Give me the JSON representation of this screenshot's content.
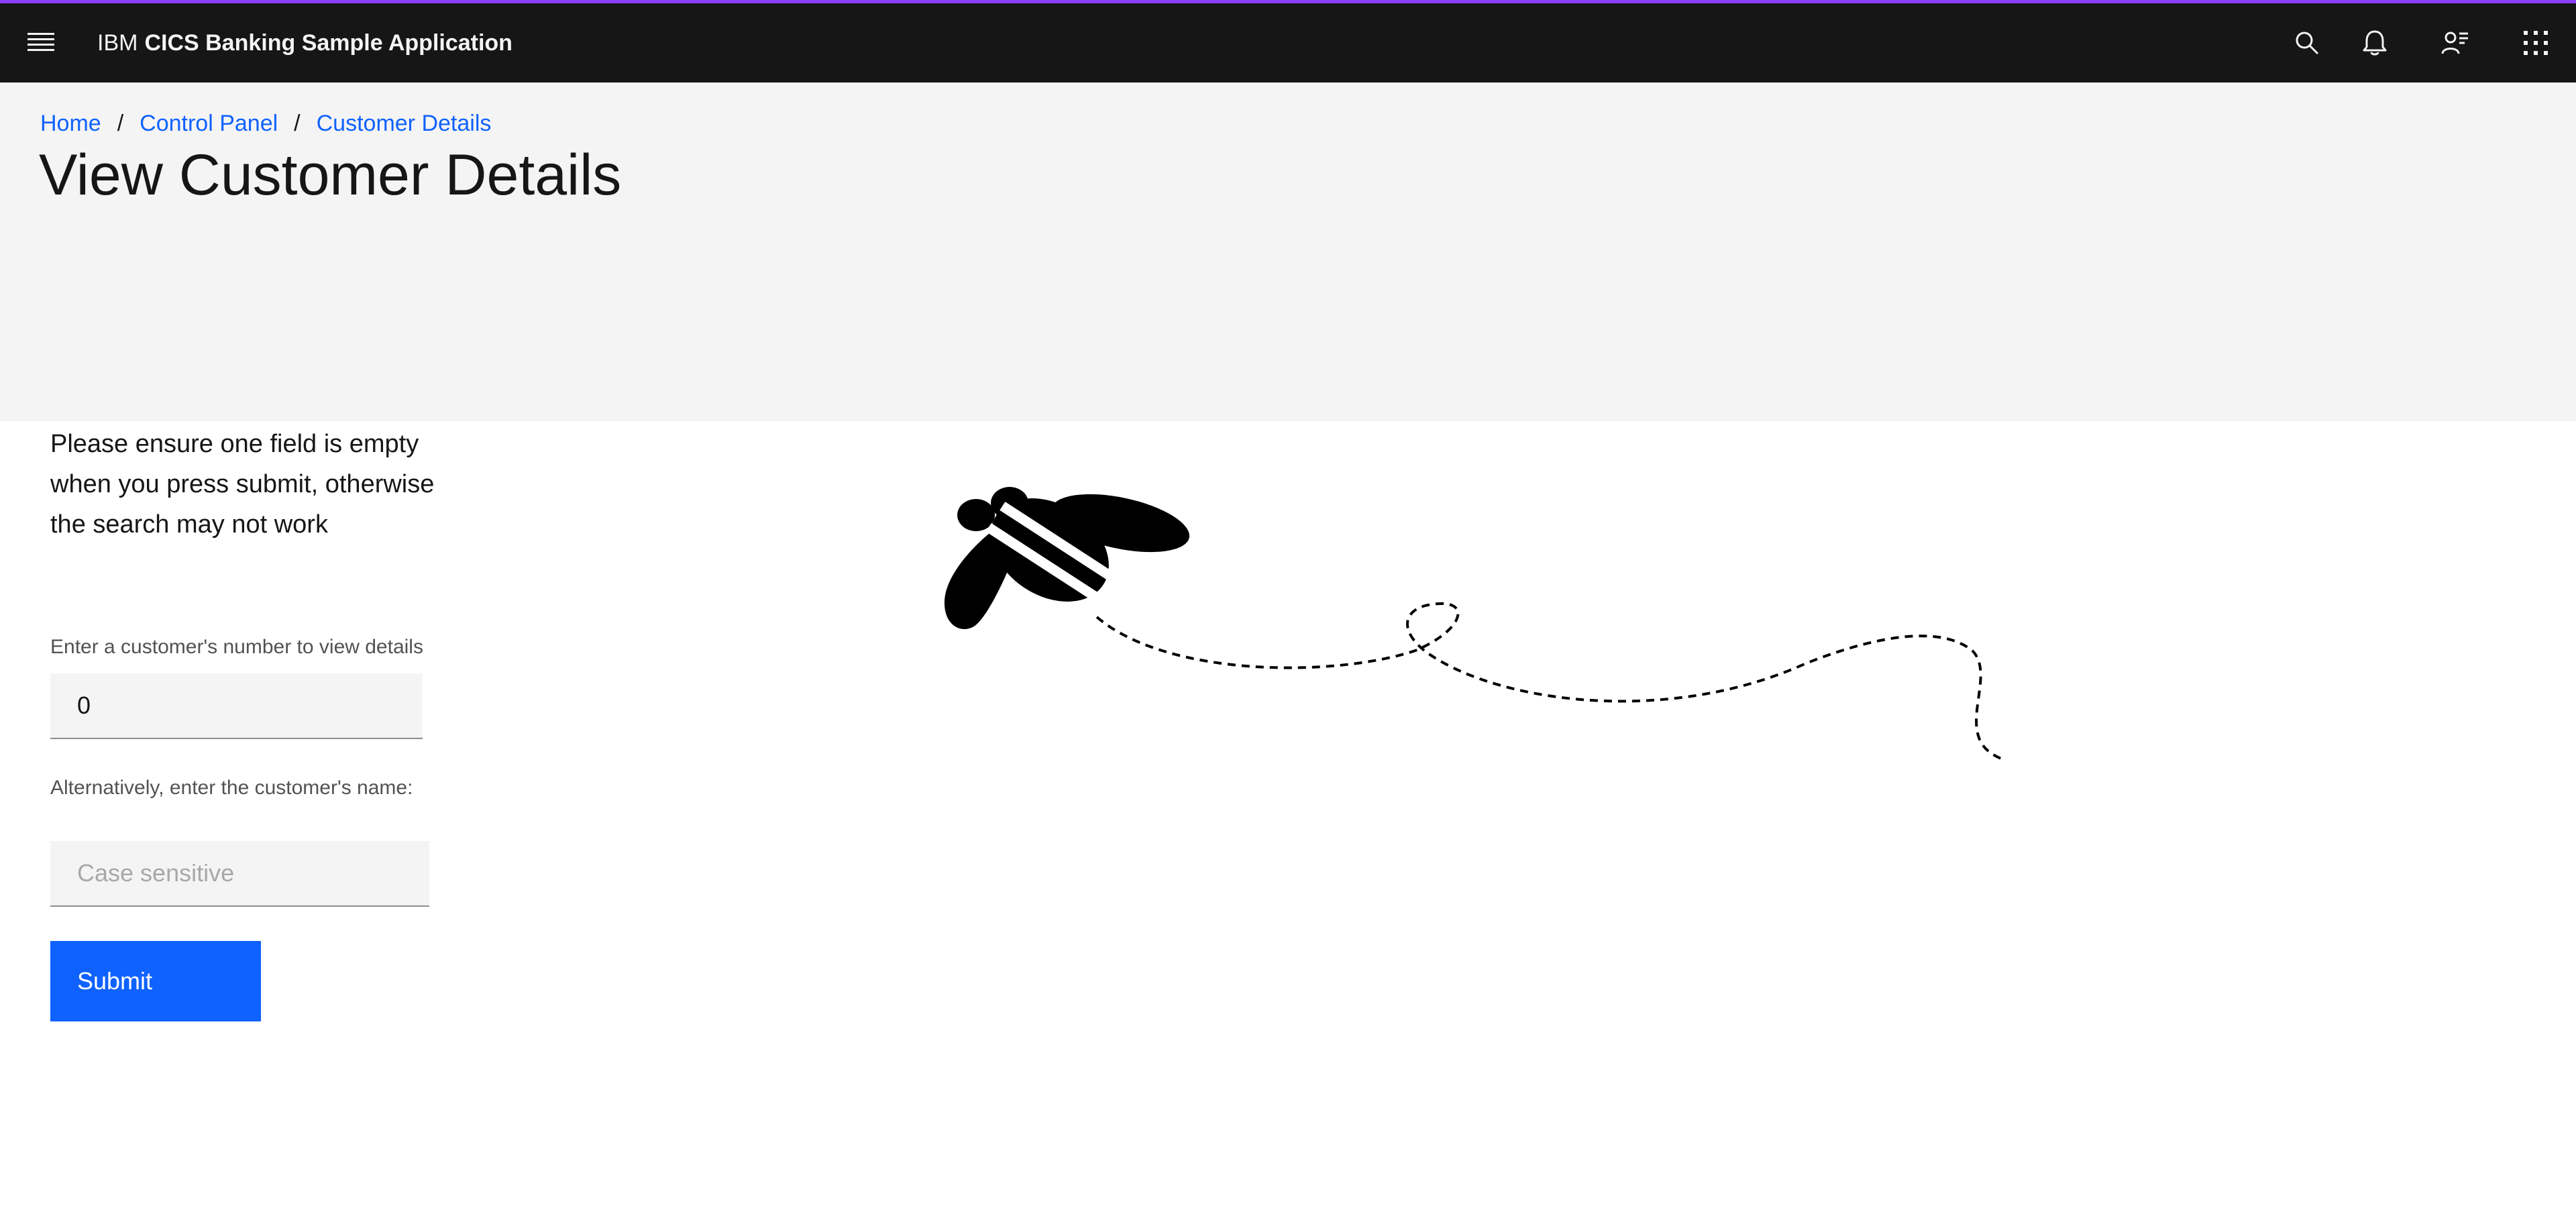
{
  "header": {
    "brand_prefix": "IBM",
    "brand_name": "CICS Banking Sample Application",
    "icons": [
      "menu-icon",
      "search-icon",
      "notification-icon",
      "user-icon",
      "app-switcher-icon"
    ]
  },
  "breadcrumb": {
    "items": [
      "Home",
      "Control Panel",
      "Customer Details"
    ],
    "separator": "/"
  },
  "page": {
    "title": "View Customer Details"
  },
  "form": {
    "instruction": "Please ensure one field is empty when you press submit, otherwise the search may not work",
    "customer_number_label": "Enter a customer's number to view details",
    "customer_number_value": "0",
    "customer_name_label": "Alternatively, enter the customer's name:",
    "customer_name_placeholder": "Case sensitive",
    "submit_label": "Submit"
  },
  "colors": {
    "header_bg": "#161616",
    "header_accent": "#8a3ffc",
    "link": "#0f62fe",
    "button": "#0f62fe",
    "hero_bg": "#f4f4f4"
  }
}
